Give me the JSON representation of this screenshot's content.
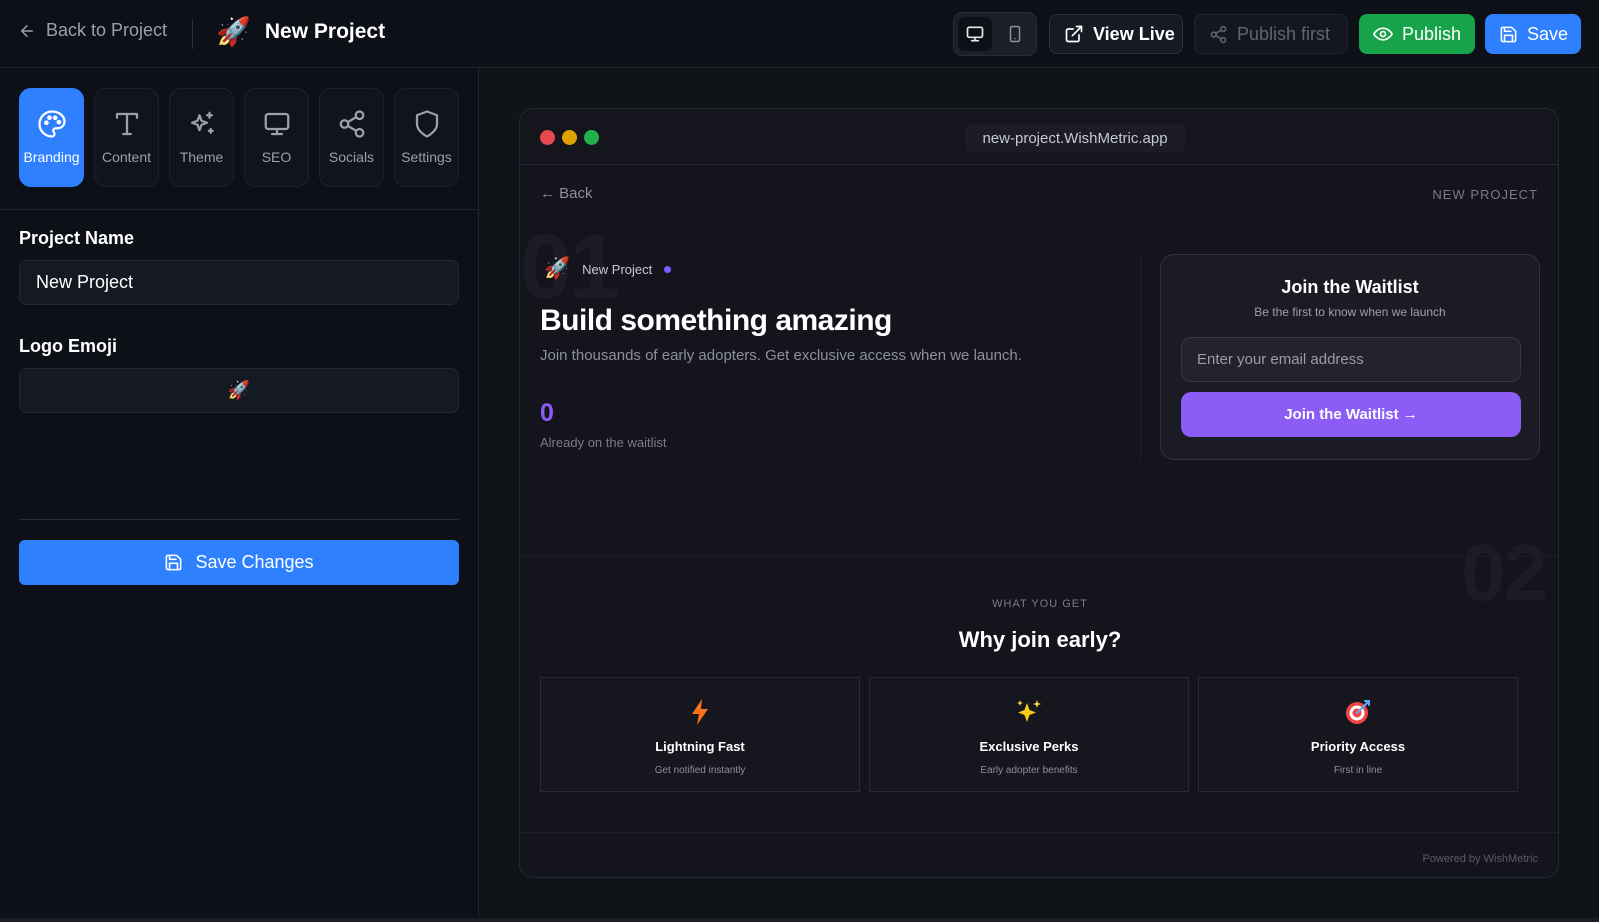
{
  "topbar": {
    "back_label": "Back to Project",
    "project_emoji": "🚀",
    "project_name": "New Project",
    "view_live_label": "View Live",
    "publish_first_label": "Publish first",
    "publish_label": "Publish",
    "save_label": "Save",
    "device_selected": "desktop"
  },
  "sidebar": {
    "tabs": [
      {
        "label": "Branding",
        "icon": "palette-icon",
        "active": true
      },
      {
        "label": "Content",
        "icon": "text-icon"
      },
      {
        "label": "Theme",
        "icon": "sparkles-icon"
      },
      {
        "label": "SEO",
        "icon": "monitor-icon"
      },
      {
        "label": "Socials",
        "icon": "share-icon"
      },
      {
        "label": "Settings",
        "icon": "shield-icon"
      }
    ],
    "project_name_label": "Project Name",
    "project_name_value": "New Project",
    "logo_emoji_label": "Logo Emoji",
    "logo_emoji_value": "🚀",
    "save_changes_label": "Save Changes"
  },
  "preview": {
    "url": "new-project.WishMetric.app",
    "back_label": "← Back",
    "header_tag": "NEW PROJECT",
    "section_num_1": "01",
    "section_num_2": "02",
    "brand_emoji": "🚀",
    "brand_name": "New Project",
    "headline": "Build something amazing",
    "subheadline": "Join thousands of early adopters. Get exclusive access when we launch.",
    "waitlist_count": "0",
    "waitlist_count_label": "Already on the waitlist",
    "card": {
      "title": "Join the Waitlist",
      "subtitle": "Be the first to know when we launch",
      "email_placeholder": "Enter your email address",
      "button_label": "Join the Waitlist →"
    },
    "features_eyebrow": "WHAT YOU GET",
    "features_title": "Why join early?",
    "features": [
      {
        "icon": "lightning-icon",
        "title": "Lightning Fast",
        "desc": "Get notified instantly"
      },
      {
        "icon": "sparkles-icon",
        "title": "Exclusive Perks",
        "desc": "Early adopter benefits"
      },
      {
        "icon": "target-icon",
        "title": "Priority Access",
        "desc": "First in line"
      }
    ],
    "footer": "Powered by WishMetric"
  },
  "colors": {
    "accent_blue": "#2f80ff",
    "publish_green": "#16a34a",
    "preview_purple": "#8b5cf6",
    "traffic_red": "#e5484d",
    "traffic_yellow": "#e0a100",
    "traffic_green": "#22b14c"
  }
}
